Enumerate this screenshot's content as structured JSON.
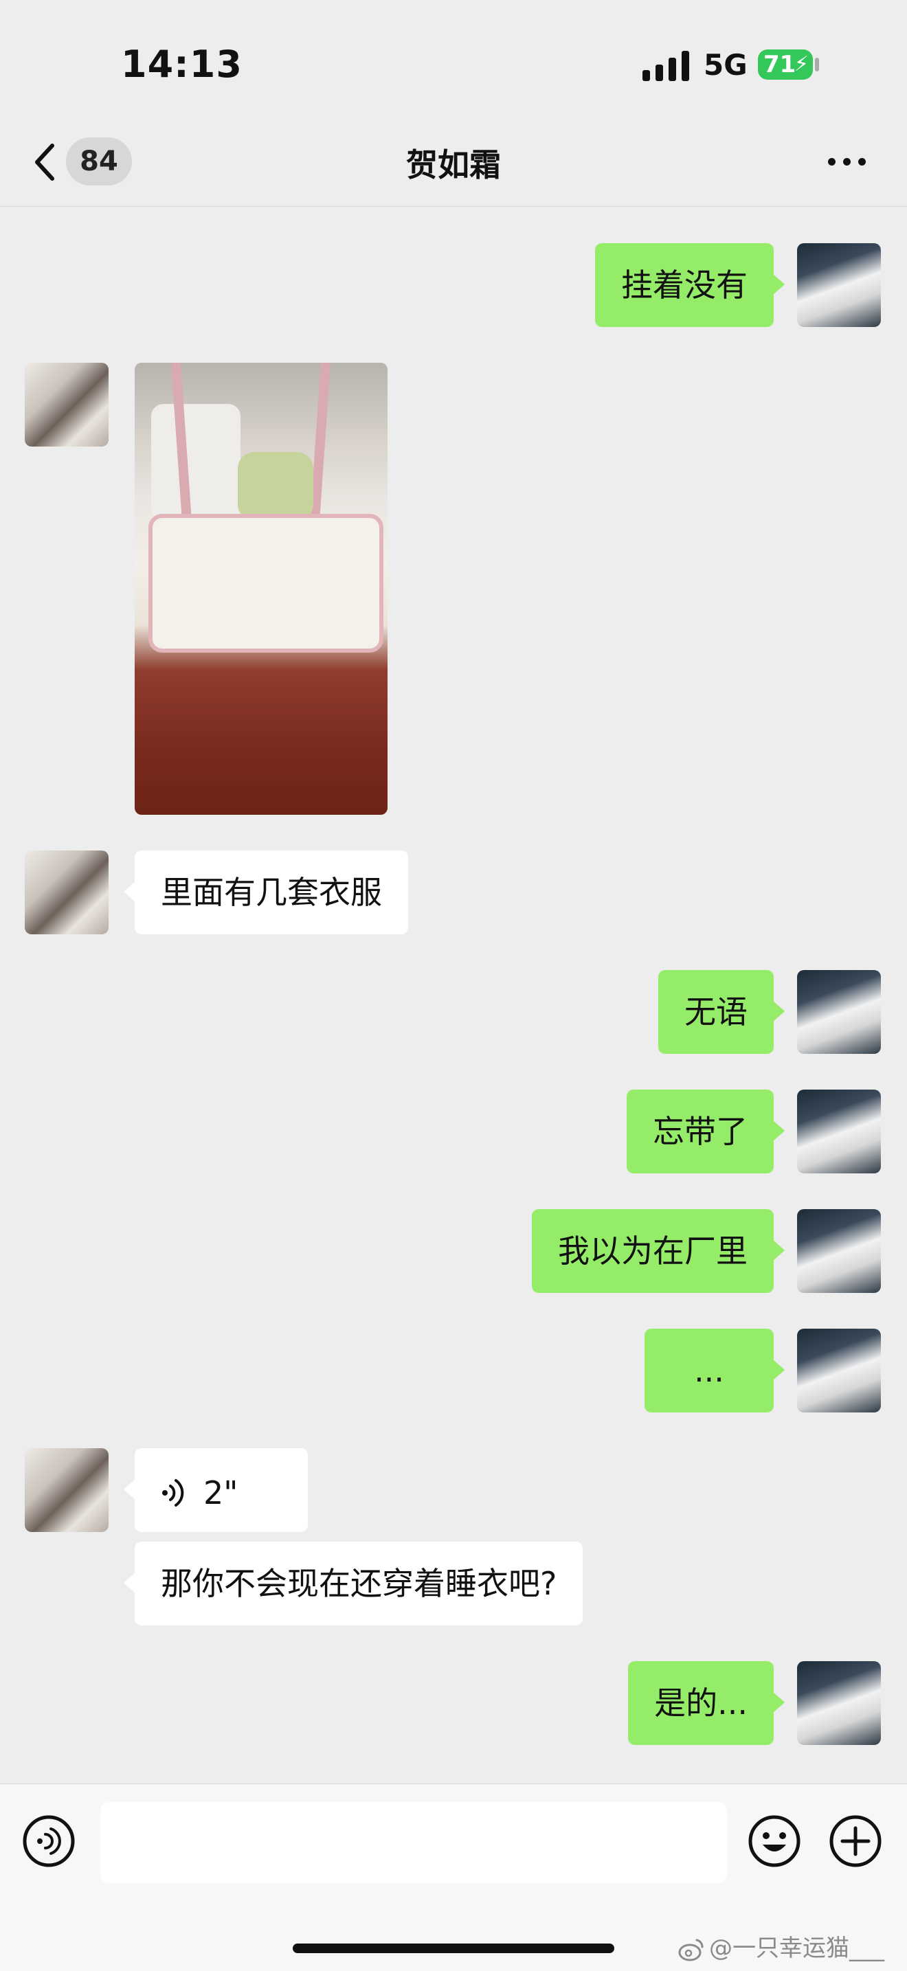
{
  "status_bar": {
    "time": "14:13",
    "network": "5G",
    "battery": "71"
  },
  "nav": {
    "back_badge": "84",
    "title": "贺如霜"
  },
  "messages": [
    {
      "side": "self",
      "text": "挂着没有"
    },
    {
      "side": "other",
      "type": "image"
    },
    {
      "side": "other",
      "text": "里面有几套衣服"
    },
    {
      "side": "self",
      "text": "无语"
    },
    {
      "side": "self",
      "text": "忘带了"
    },
    {
      "side": "self",
      "text": "我以为在厂里"
    },
    {
      "side": "self",
      "text": "..."
    },
    {
      "side": "other",
      "type": "voice",
      "text": "2\""
    },
    {
      "side": "other",
      "text": "那你不会现在还穿着睡衣吧?"
    },
    {
      "side": "self",
      "text": "是的..."
    }
  ],
  "input_bar": {
    "placeholder": ""
  },
  "watermark": "@一只幸运猫___"
}
